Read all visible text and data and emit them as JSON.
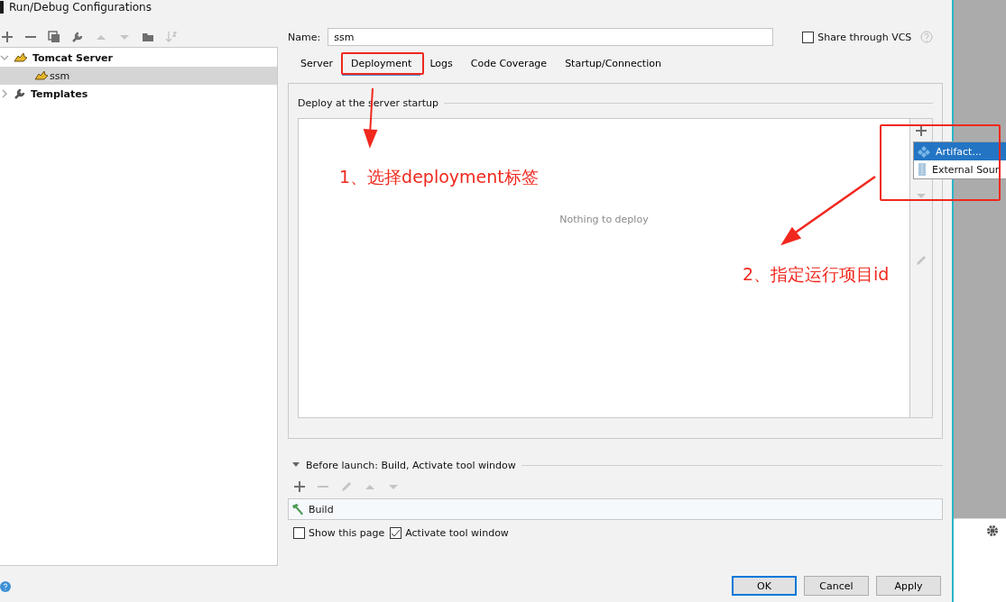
{
  "window": {
    "title": "Run/Debug Configurations"
  },
  "toolbar": [
    {
      "kind": "add",
      "disabled": false
    },
    {
      "kind": "remove",
      "disabled": false
    },
    {
      "kind": "copy",
      "disabled": false
    },
    {
      "kind": "wrench",
      "disabled": false
    },
    {
      "kind": "up",
      "disabled": true
    },
    {
      "kind": "down",
      "disabled": true
    },
    {
      "kind": "folder",
      "disabled": false
    },
    {
      "kind": "sort",
      "disabled": true
    }
  ],
  "tree": [
    {
      "label": "Tomcat Server",
      "kind": "tomcat",
      "expanded": true,
      "selected": false,
      "children": [
        {
          "label": "ssm",
          "kind": "tomcat",
          "selected": true
        }
      ]
    },
    {
      "label": "Templates",
      "kind": "wrench",
      "expanded": false,
      "selected": false
    }
  ],
  "name_field": {
    "label": "Name:",
    "value": "ssm"
  },
  "share": {
    "label": "Share through VCS",
    "checked": false
  },
  "tabs": [
    {
      "label": "Server",
      "selected": false
    },
    {
      "label": "Deployment",
      "selected": true
    },
    {
      "label": "Logs",
      "selected": false
    },
    {
      "label": "Code Coverage",
      "selected": false
    },
    {
      "label": "Startup/Connection",
      "selected": false
    }
  ],
  "deploy": {
    "title": "Deploy at the server startup",
    "empty_text": "Nothing to deploy",
    "side_tools": [
      {
        "kind": "add",
        "disabled": false
      },
      {
        "kind": "down",
        "disabled": true
      },
      {
        "kind": "edit",
        "disabled": true
      }
    ]
  },
  "popup": {
    "items": [
      {
        "label": "Artifact...",
        "kind": "artifact",
        "selected": true
      },
      {
        "label": "External Sour",
        "kind": "external",
        "selected": false
      }
    ]
  },
  "before_launch": {
    "title": "Before launch: Build, Activate tool window",
    "expanded": true,
    "tools": [
      {
        "kind": "add",
        "disabled": false
      },
      {
        "kind": "remove",
        "disabled": true
      },
      {
        "kind": "edit",
        "disabled": true
      },
      {
        "kind": "up",
        "disabled": true
      },
      {
        "kind": "down",
        "disabled": true
      }
    ],
    "tasks": [
      {
        "label": "Build"
      }
    ]
  },
  "options": [
    {
      "label": "Show this page",
      "checked": false
    },
    {
      "label": "Activate tool window",
      "checked": true
    }
  ],
  "buttons": [
    {
      "label": "OK",
      "default": true
    },
    {
      "label": "Cancel",
      "default": false
    },
    {
      "label": "Apply",
      "default": false
    }
  ],
  "annotations": [
    {
      "text": "1、选择deployment标签"
    },
    {
      "text": "2、指定运行项目id"
    }
  ]
}
